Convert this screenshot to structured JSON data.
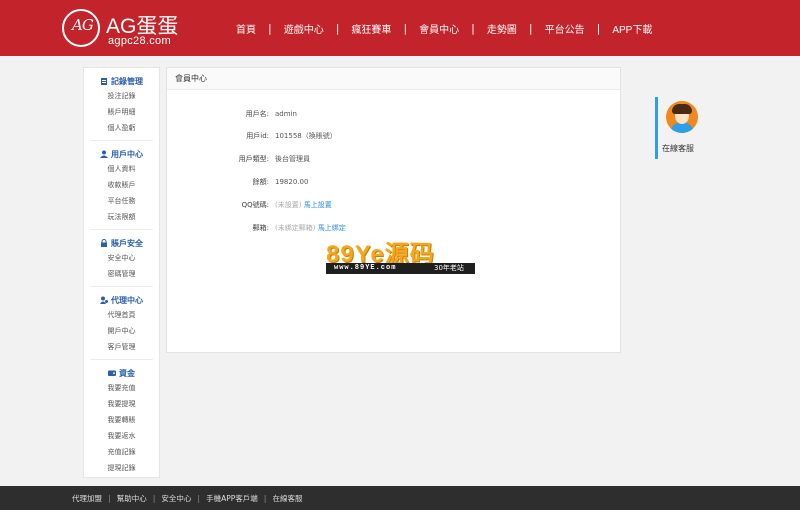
{
  "brand": {
    "logo_mark": "AG",
    "title": "AG蛋蛋",
    "domain": "agpc28.com"
  },
  "nav": [
    "首頁",
    "遊戲中心",
    "瘋狂賽車",
    "會員中心",
    "走勢圖",
    "平台公告",
    "APP下載"
  ],
  "sidebar": [
    {
      "title": "記錄管理",
      "icon": "clipboard-icon",
      "items": [
        "投注記錄",
        "賬戶明細",
        "個人盈虧"
      ]
    },
    {
      "title": "用戶中心",
      "icon": "user-icon",
      "items": [
        "個人資料",
        "收款賬戶",
        "平台任務",
        "玩法限額"
      ]
    },
    {
      "title": "賬戶安全",
      "icon": "lock-icon",
      "items": [
        "安全中心",
        "密碼管理"
      ]
    },
    {
      "title": "代理中心",
      "icon": "agent-icon",
      "items": [
        "代理首頁",
        "開戶中心",
        "客戶管理"
      ]
    },
    {
      "title": "資金",
      "icon": "wallet-icon",
      "items": [
        "我要充值",
        "我要提現",
        "我要轉賬",
        "我要返水",
        "充值記錄",
        "提現記錄"
      ]
    }
  ],
  "panel": {
    "title": "會員中心",
    "rows": [
      {
        "label": "用戶名:",
        "value": "admin"
      },
      {
        "label": "用戶id:",
        "value": "101558（換賬號）"
      },
      {
        "label": "用戶類型:",
        "value": "後台管理員"
      },
      {
        "label": "餘額:",
        "value": "19820.00"
      },
      {
        "label": "QQ號碼:",
        "value": "(未設置)",
        "link": "馬上設置"
      },
      {
        "label": "郵箱:",
        "value": "(未綁定郵箱)",
        "link": "馬上綁定"
      }
    ]
  },
  "customer_service": {
    "label": "在線客服"
  },
  "watermark": {
    "big": "89Ye源码",
    "small": "www.89YE.com",
    "small2": "30年老站"
  },
  "footer": [
    "代理加盟",
    "幫助中心",
    "安全中心",
    "手機APP客戶端",
    "在線客服"
  ],
  "colors": {
    "header": "#c3232b",
    "accent": "#2b8de0",
    "sidebar_head": "#2a5faa",
    "footer": "#2e2e2e"
  }
}
